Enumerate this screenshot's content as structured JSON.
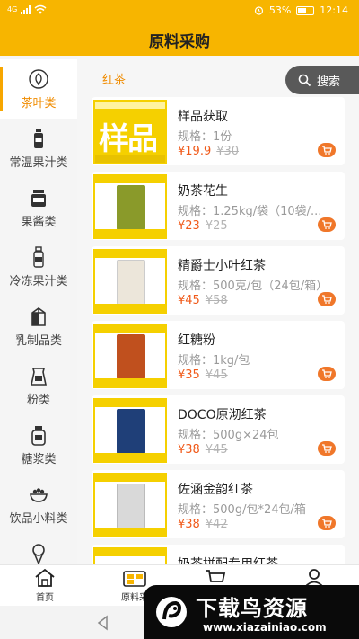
{
  "status_bar": {
    "carrier": "4G",
    "battery": "53%",
    "time": "12:14"
  },
  "header": {
    "title": "原料采购"
  },
  "sidebar": {
    "items": [
      {
        "label": "茶叶类",
        "icon": "leaf-icon",
        "active": true
      },
      {
        "label": "常温果汁类",
        "icon": "bottle-icon"
      },
      {
        "label": "果酱类",
        "icon": "jar-icon"
      },
      {
        "label": "冷冻果汁类",
        "icon": "bottle-icon"
      },
      {
        "label": "乳制品类",
        "icon": "milk-box-icon"
      },
      {
        "label": "粉类",
        "icon": "powder-bag-icon"
      },
      {
        "label": "糖浆类",
        "icon": "syrup-icon"
      },
      {
        "label": "饮品小料类",
        "icon": "bowl-icon"
      },
      {
        "label": "",
        "icon": "ice-cream-icon"
      }
    ]
  },
  "main": {
    "section": "红茶",
    "search_label": "搜索",
    "products": [
      {
        "name": "样品获取",
        "spec": "规格：1份",
        "price": "¥19.9",
        "old_price": "¥30",
        "thumb": "sample",
        "pkg_color": "#f5d000"
      },
      {
        "name": "奶茶花生",
        "spec": "规格：1.25kg/袋（10袋/...",
        "price": "¥23",
        "old_price": "¥25",
        "thumb": "product",
        "pkg_color": "#8a9a2a"
      },
      {
        "name": "精爵士小叶红茶",
        "spec": "规格：500克/包（24包/箱）",
        "price": "¥45",
        "old_price": "¥58",
        "thumb": "product",
        "pkg_color": "#ece6da"
      },
      {
        "name": "红糖粉",
        "spec": "规格：1kg/包",
        "price": "¥35",
        "old_price": "¥45",
        "thumb": "product",
        "pkg_color": "#c0501e"
      },
      {
        "name": "DOCO原沏红茶",
        "spec": "规格：500g×24包",
        "price": "¥38",
        "old_price": "¥45",
        "thumb": "product",
        "pkg_color": "#1f3f78"
      },
      {
        "name": "佐涵金韵红茶",
        "spec": "规格：500g/包*24包/箱",
        "price": "¥38",
        "old_price": "¥42",
        "thumb": "product",
        "pkg_color": "#d9d9d9"
      },
      {
        "name": "奶茶拼配专用红茶",
        "spec": "",
        "price": "",
        "old_price": "",
        "thumb": "product",
        "pkg_color": "#c9c9c9"
      }
    ]
  },
  "bottom_nav": {
    "items": [
      {
        "label": "首页",
        "icon": "home-icon"
      },
      {
        "label": "原料采",
        "icon": "purchase-icon"
      },
      {
        "label": "",
        "icon": "cart-icon"
      },
      {
        "label": "",
        "icon": "profile-icon"
      }
    ]
  },
  "watermark": {
    "title": "下载鸟资源",
    "url": "www.xiazainiao.com"
  },
  "colors": {
    "primary": "#f7b500",
    "accent": "#f08c00",
    "price": "#f05a1a",
    "cart": "#f0772a"
  }
}
